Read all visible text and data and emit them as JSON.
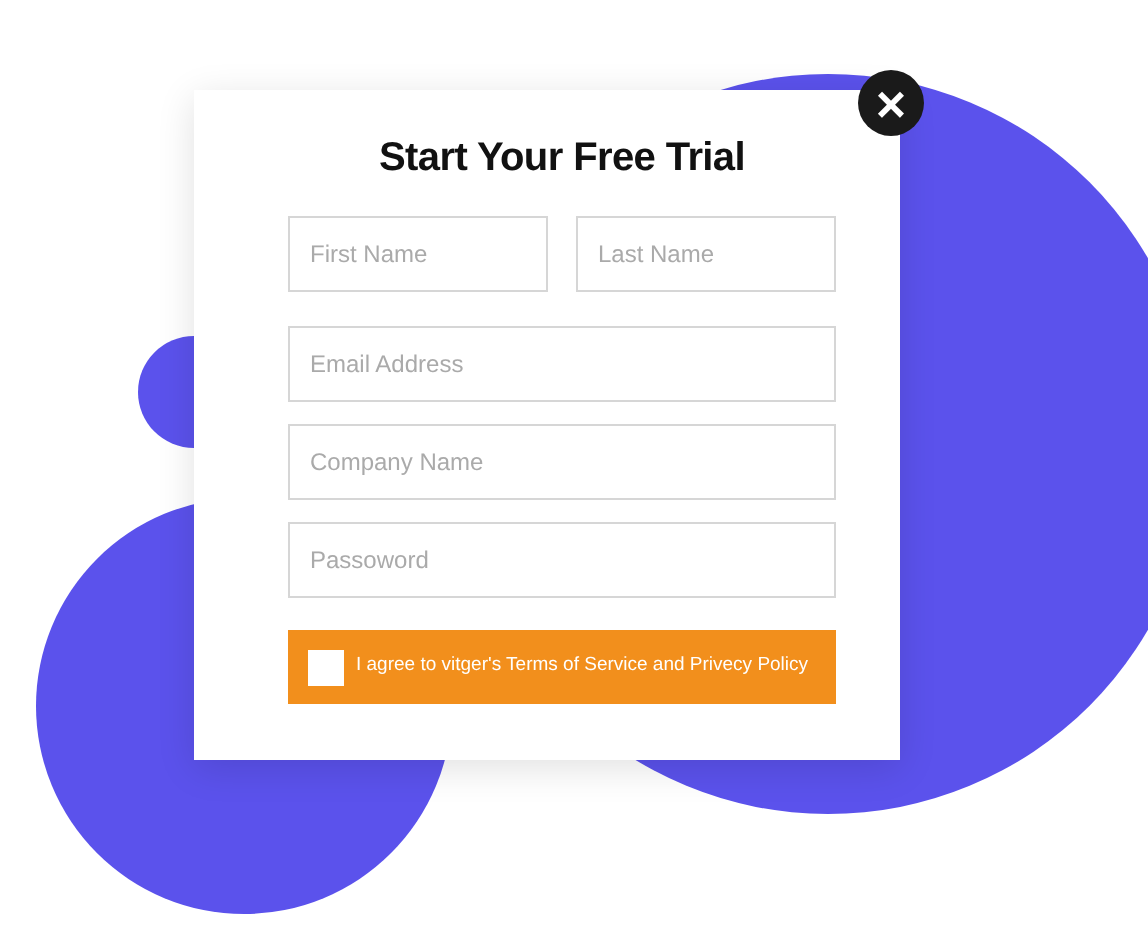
{
  "title": "Start Your Free Trial",
  "name_fields": [
    {
      "placeholder": "First Name"
    },
    {
      "placeholder": "Last Name"
    }
  ],
  "fields": [
    {
      "placeholder": "Email Address"
    },
    {
      "placeholder": "Company Name"
    },
    {
      "placeholder": "Passoword"
    }
  ],
  "agreement": {
    "label": "I agree to vitger's Terms of Service and Privecy Policy",
    "checked": false
  },
  "close": {
    "label": "×"
  }
}
